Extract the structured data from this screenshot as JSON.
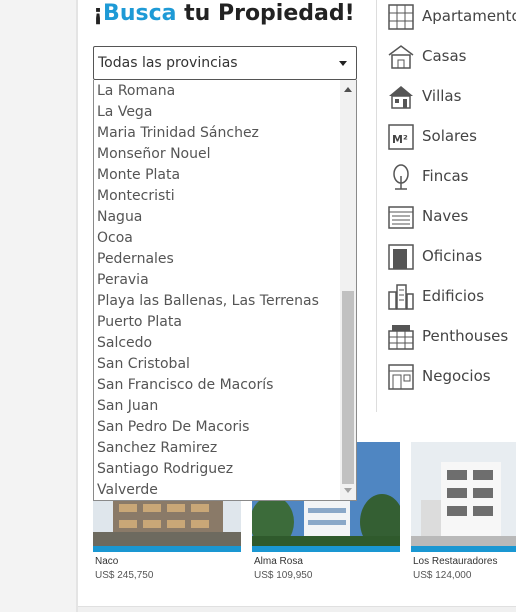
{
  "hero": {
    "title_prefix": "¡",
    "title_brand": "Busca",
    "title_suffix": " tu Propiedad!"
  },
  "province_select": {
    "selected": "Todas las provincias",
    "options_visible": [
      "La Romana",
      "La Vega",
      "Maria Trinidad Sánchez",
      "Monseñor Nouel",
      "Monte Plata",
      "Montecristi",
      "Nagua",
      "Ocoa",
      "Pedernales",
      "Peravia",
      "Playa las Ballenas, Las Terrenas",
      "Puerto Plata",
      "Salcedo",
      "San Cristobal",
      "San Francisco de Macorís",
      "San Juan",
      "San Pedro De Macoris",
      "Sanchez Ramirez",
      "Santiago Rodriguez",
      "Valverde"
    ]
  },
  "property_types": [
    {
      "label": "Apartamento",
      "icon": "apartment-icon"
    },
    {
      "label": "Casas",
      "icon": "house-icon"
    },
    {
      "label": "Villas",
      "icon": "villa-icon"
    },
    {
      "label": "Solares",
      "icon": "land-m2-icon"
    },
    {
      "label": "Fincas",
      "icon": "tree-icon"
    },
    {
      "label": "Naves",
      "icon": "warehouse-icon"
    },
    {
      "label": "Oficinas",
      "icon": "office-door-icon"
    },
    {
      "label": "Edificios",
      "icon": "buildings-icon"
    },
    {
      "label": "Penthouses",
      "icon": "penthouse-icon"
    },
    {
      "label": "Negocios",
      "icon": "storefront-icon"
    }
  ],
  "listings": [
    {
      "name": "Naco",
      "price": "US$ 245,750"
    },
    {
      "name": "Alma Rosa",
      "price": "US$ 109,950"
    },
    {
      "name": "Los Restauradores",
      "price": "US$ 124,000"
    }
  ],
  "colors": {
    "brand_blue": "#1e9ad6",
    "card_bar": "#1a97d2",
    "text_gray": "#555555"
  }
}
